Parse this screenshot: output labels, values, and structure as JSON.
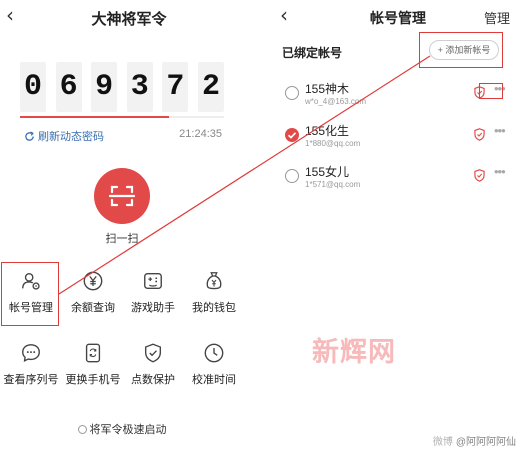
{
  "colors": {
    "accent": "#e24a4a",
    "annotation": "#e03b3b",
    "link": "#3a6fb0"
  },
  "left": {
    "back_icon": "chevron-left-icon",
    "title": "大神将军令",
    "code_digits": [
      "0",
      "6",
      "9",
      "3",
      "7",
      "2"
    ],
    "countdown_fraction": 0.73,
    "refresh_label": "刷新动态密码",
    "time": "21:24:35",
    "scan_label": "扫一扫",
    "grid": [
      {
        "label": "帐号管理",
        "icon": "user-gear-icon"
      },
      {
        "label": "余额查询",
        "icon": "yen-coin-icon"
      },
      {
        "label": "游戏助手",
        "icon": "gamepad-icon"
      },
      {
        "label": "我的钱包",
        "icon": "money-bag-icon"
      },
      {
        "label": "查看序列号",
        "icon": "chat-dots-icon"
      },
      {
        "label": "更换手机号",
        "icon": "phone-swap-icon"
      },
      {
        "label": "点数保护",
        "icon": "shield-check-icon"
      },
      {
        "label": "校准时间",
        "icon": "clock-icon"
      }
    ],
    "quick_start_label": "将军令极速启动"
  },
  "right": {
    "back_icon": "chevron-left-icon",
    "title": "帐号管理",
    "manage_label": "管理",
    "section_title": "已绑定帐号",
    "add_label": "+ 添加新帐号",
    "accounts": [
      {
        "name": "155神木",
        "email": "w*o_4@163.com",
        "selected": false
      },
      {
        "name": "155化生",
        "email": "1*880@qq.com",
        "selected": true
      },
      {
        "name": "155女儿",
        "email": "1*571@qq.com",
        "selected": false
      }
    ],
    "more_label": "•••"
  },
  "watermark": "新辉网",
  "credit_prefix": "微博",
  "credit": "@阿阿阿阿仙"
}
